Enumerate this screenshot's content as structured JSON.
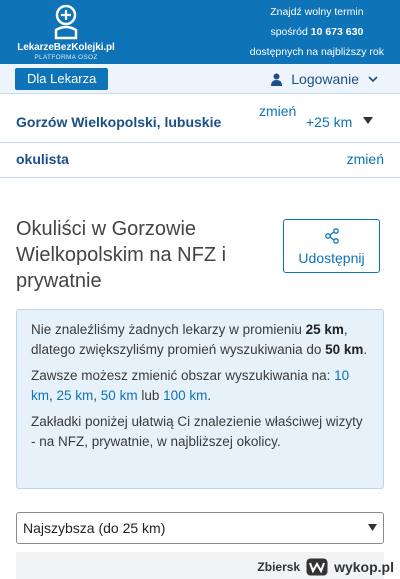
{
  "header": {
    "logo_text": "LekarzeBezKolejki.pl",
    "logo_sub": "PLATFORMA OSOZ",
    "promo_line1": "Znajdź wolny termin",
    "promo_line2_prefix": "spośród",
    "promo_count": "10 673 630",
    "promo_line3": "dostępnych na najbliższy rok"
  },
  "nav": {
    "dla_lekarza": "Dla Lekarza",
    "login": "Logowanie"
  },
  "search": {
    "location": "Gorzów Wielkopolski, lubuskie",
    "change_location": "zmień",
    "radius": "+25 km",
    "specialty": "okulista",
    "change_specialty": "zmień"
  },
  "page": {
    "title": "Okuliści w Gorzowie Wielkopolskim na NFZ i prywatnie",
    "share_label": "Udostępnij"
  },
  "info": {
    "p1_a": "Nie znaleźliśmy żadnych lekarzy w promieniu ",
    "p1_b": "25 km",
    "p1_c": ", dlatego zwiększyliśmy promień wyszukiwania do ",
    "p1_d": "50 km",
    "p1_e": ".",
    "p2_a": "Zawsze możesz zmienić obszar wyszukiwania na: ",
    "opt1": "10 km",
    "sep1": ", ",
    "opt2": "25 km",
    "sep2": ", ",
    "opt3": "50 km",
    "sep3": " lub ",
    "opt4": "100 km",
    "p2_e": ".",
    "p3": "Zakładki poniżej ułatwią Ci znalezienie właściwej wizyty - na NFZ, prywatnie, w najbliższej okolicy."
  },
  "sort": {
    "selected": "Najszybsza (do 25 km)"
  },
  "watermark": {
    "user": "Zbiersk",
    "brand": "wykop.pl"
  },
  "colors": {
    "primary": "#0e73b7",
    "info_bg": "#e6f1fa"
  }
}
